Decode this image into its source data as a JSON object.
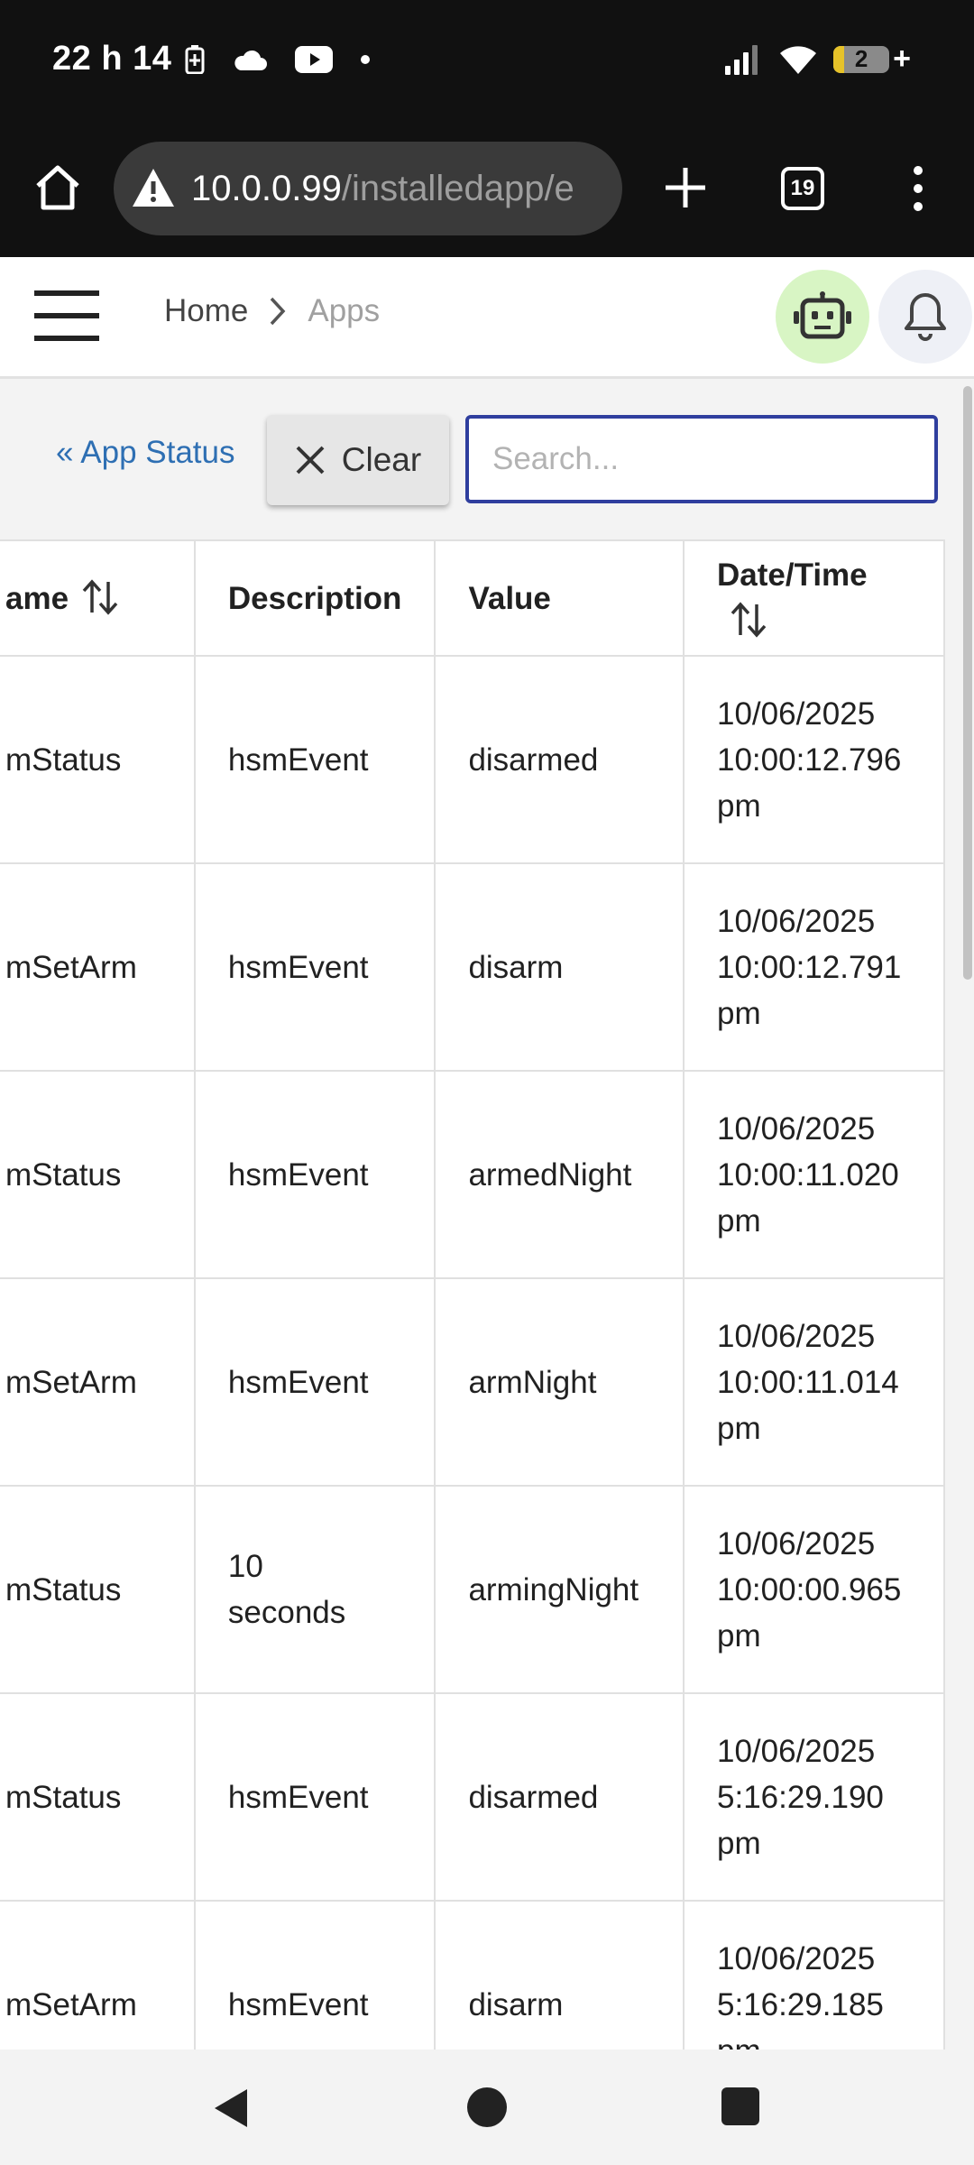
{
  "status_bar": {
    "time": "22 h 14",
    "battery_level": "2"
  },
  "browser": {
    "url_host": "10.0.0.99",
    "url_path": "/installedapp/e",
    "tab_count": "19"
  },
  "app_bar": {
    "breadcrumb": [
      "Home",
      "Apps"
    ]
  },
  "toolbar": {
    "app_status_link": "« App Status",
    "clear_label": "Clear",
    "search_placeholder": "Search..."
  },
  "table": {
    "columns": [
      "ame",
      "Description",
      "Value",
      "Date/Time"
    ],
    "rows": [
      [
        "mStatus",
        "hsmEvent",
        "disarmed",
        "10/06/2025\n10:00:12.796\npm"
      ],
      [
        "mSetArm",
        "hsmEvent",
        "disarm",
        "10/06/2025\n10:00:12.791\npm"
      ],
      [
        "mStatus",
        "hsmEvent",
        "armedNight",
        "10/06/2025\n10:00:11.020\npm"
      ],
      [
        "mSetArm",
        "hsmEvent",
        "armNight",
        "10/06/2025\n10:00:11.014\npm"
      ],
      [
        "mStatus",
        "10\nseconds",
        "armingNight",
        "10/06/2025\n10:00:00.965\npm"
      ],
      [
        "mStatus",
        "hsmEvent",
        "disarmed",
        "10/06/2025\n5:16:29.190\npm"
      ],
      [
        "mSetArm",
        "hsmEvent",
        "disarm",
        "10/06/2025\n5:16:29.185\npm"
      ]
    ]
  }
}
